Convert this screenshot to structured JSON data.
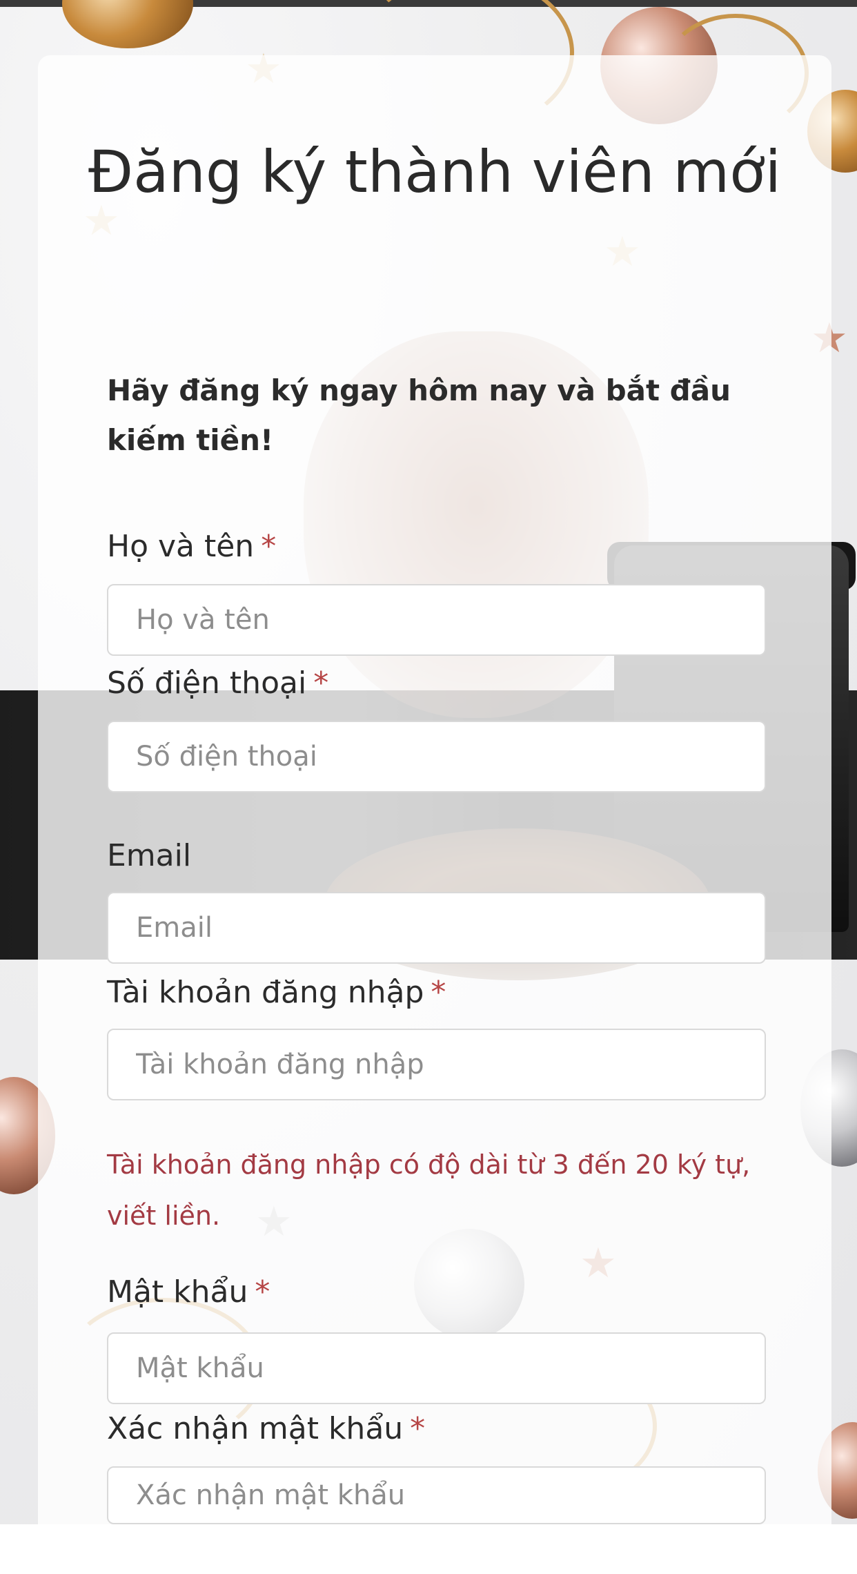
{
  "form": {
    "title": "Đăng ký thành viên mới",
    "subtitle": "Hãy đăng ký ngay hôm nay và bắt đầu kiếm tiền!",
    "required_mark": "*",
    "fields": [
      {
        "label": "Họ và tên",
        "placeholder": "Họ và tên",
        "required": true
      },
      {
        "label": "Số điện thoại",
        "placeholder": "Số điện thoại",
        "required": true
      },
      {
        "label": "Email",
        "placeholder": "Email",
        "required": false
      },
      {
        "label": "Tài khoản đăng nhập",
        "placeholder": "Tài khoản đăng nhập",
        "required": true
      },
      {
        "label": "Mật khẩu",
        "placeholder": "Mật khẩu",
        "required": true
      },
      {
        "label": "Xác nhận mật khẩu",
        "placeholder": "Xác nhận mật khẩu",
        "required": true
      }
    ],
    "username_hint": "Tài khoản đăng nhập có độ dài từ 3 đến 20 ký tự, viết liền."
  }
}
